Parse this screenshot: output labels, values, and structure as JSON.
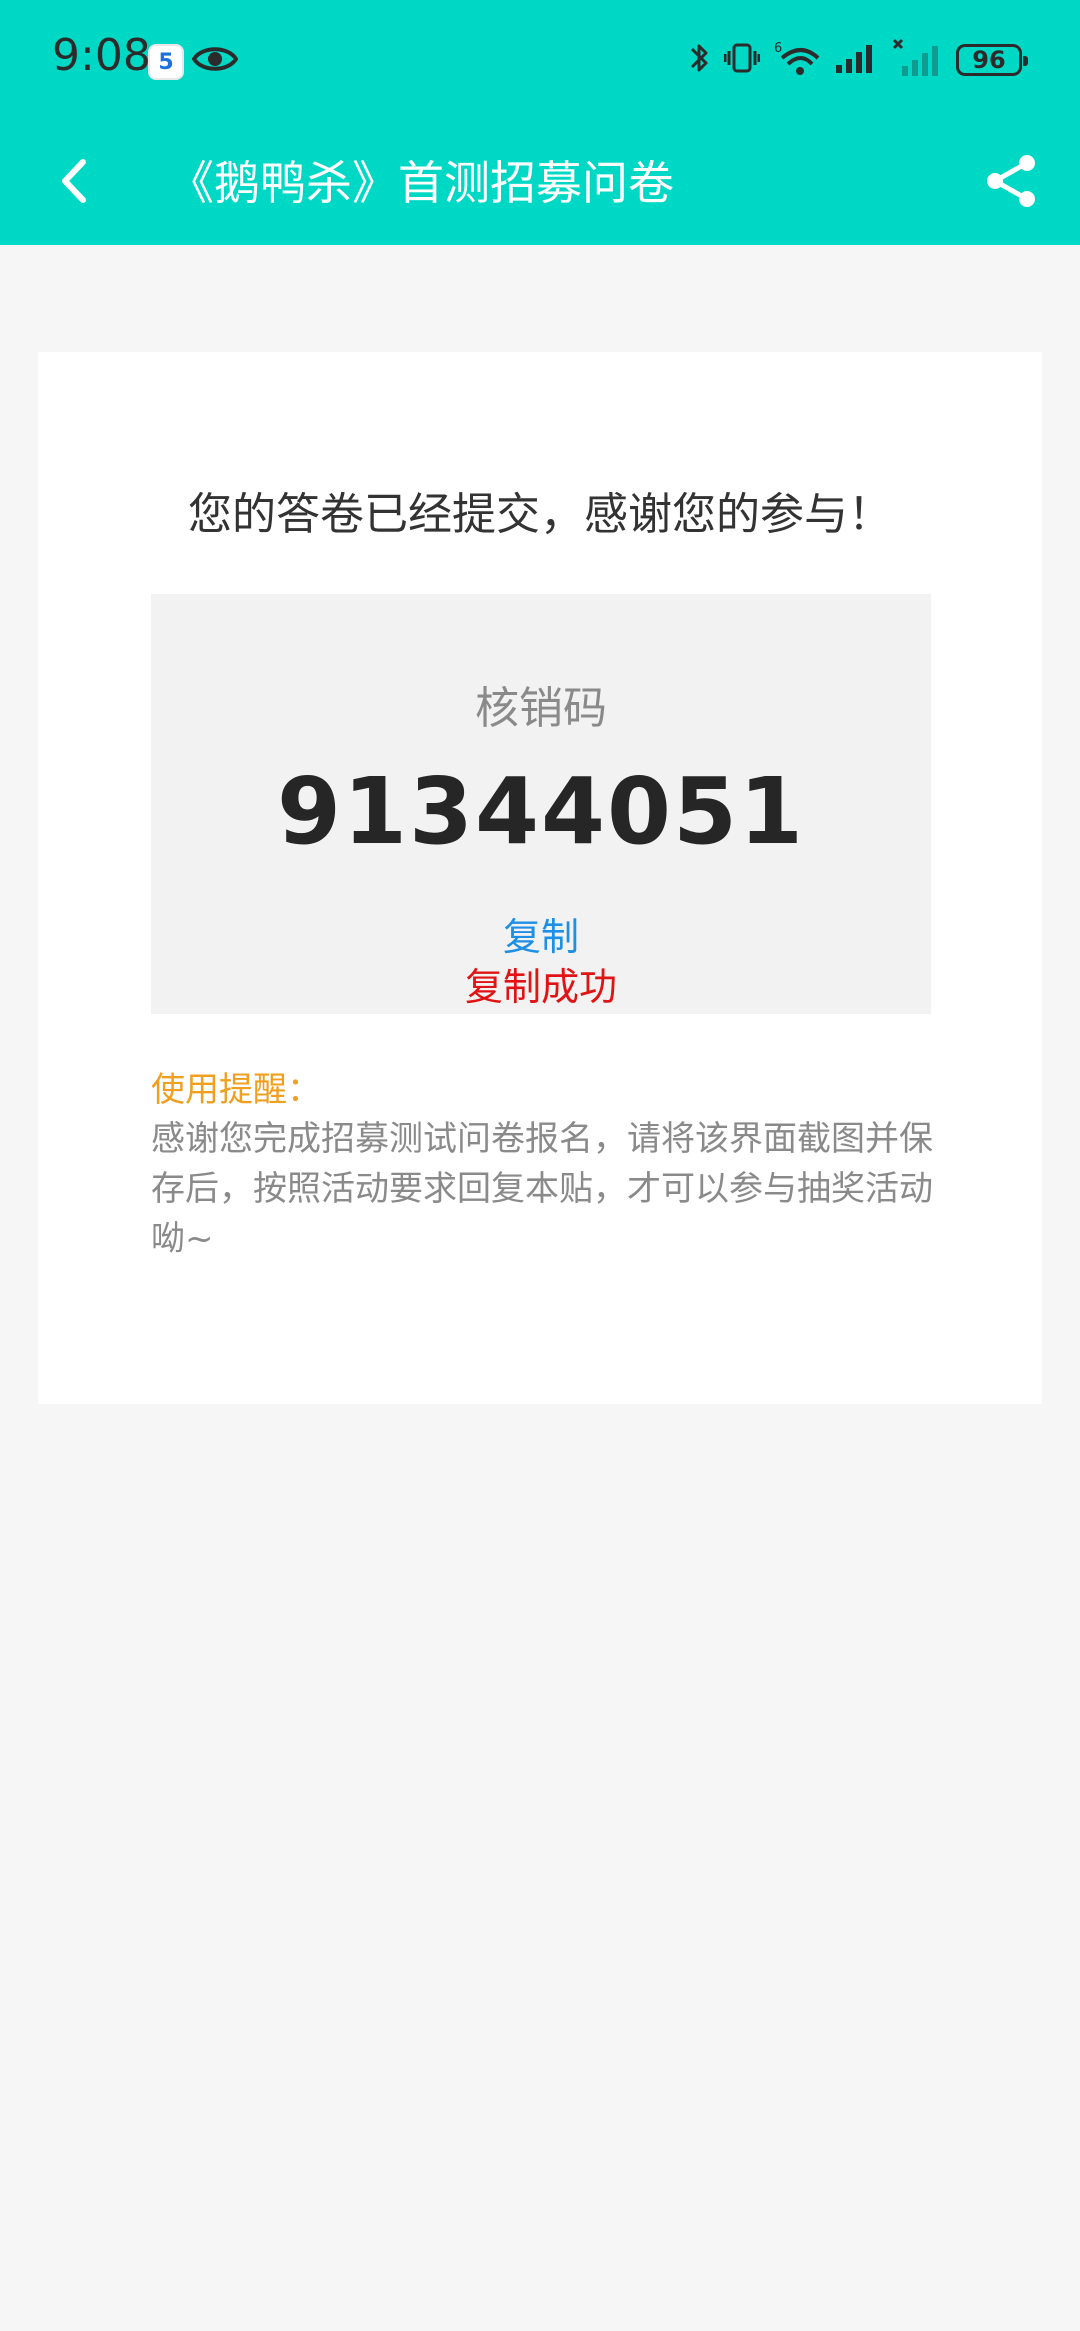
{
  "status_bar": {
    "time": "9:08",
    "battery": "96",
    "notification_badge": "5"
  },
  "navbar": {
    "title": "《鹅鸭杀》首测招募问卷"
  },
  "card": {
    "success_message": "您的答卷已经提交，感谢您的参与！",
    "code_label": "核销码",
    "code_value": "91344051",
    "copy_label": "复制",
    "copy_success": "复制成功",
    "tip_title": "使用提醒：",
    "tip_body": "感谢您完成招募测试问卷报名，请将该界面截图并保存后，按照活动要求回复本贴，才可以参与抽奖活动呦~"
  },
  "colors": {
    "accent": "#00d8c6",
    "link": "#1e8fe6",
    "success": "#e01414",
    "tip_title": "#f0a020"
  },
  "icons": {
    "back": "back-arrow-icon",
    "share": "share-icon",
    "eye": "eye-icon",
    "bluetooth": "bluetooth-icon",
    "vibrate": "vibrate-icon",
    "wifi": "wifi-icon",
    "signal": "signal-icon"
  }
}
